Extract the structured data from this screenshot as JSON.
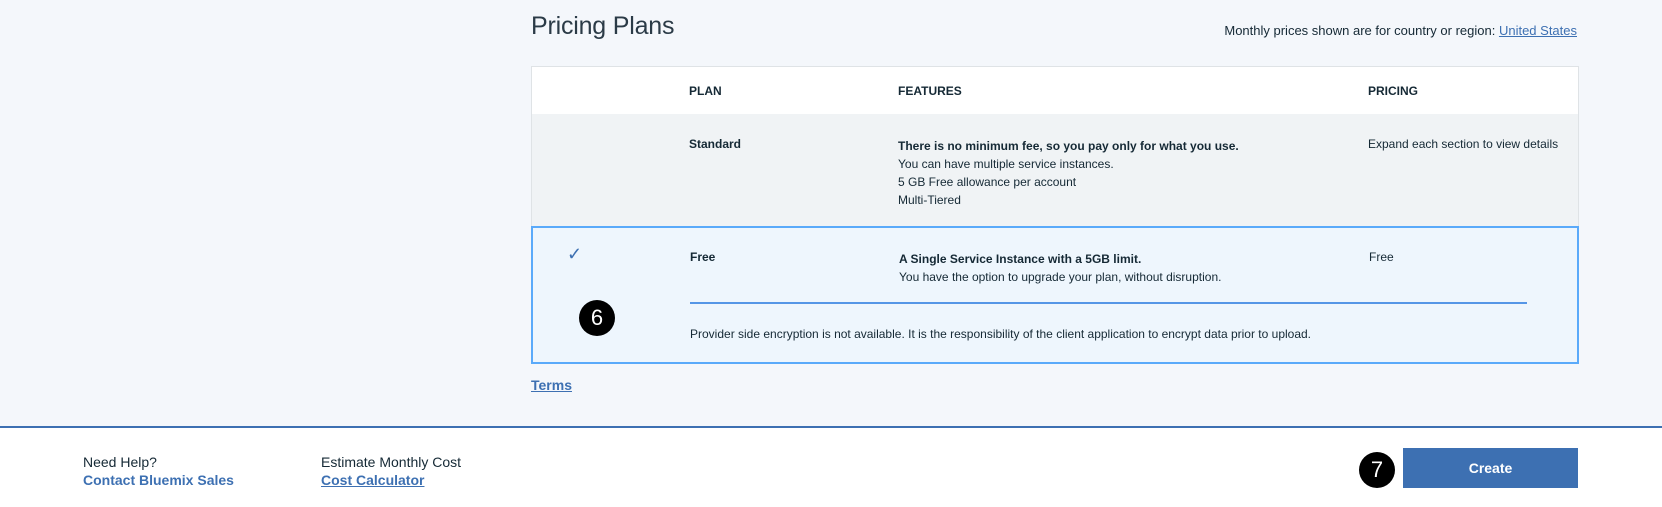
{
  "pricing": {
    "title": "Pricing Plans",
    "region_prefix": "Monthly prices shown are for country or region:",
    "region_link": "United States",
    "headers": {
      "plan": "PLAN",
      "features": "FEATURES",
      "pricing": "PRICING"
    },
    "plans": [
      {
        "name": "Standard",
        "feature_head": "There is no minimum fee, so you pay only for what you use.",
        "features": [
          "You can have multiple service instances.",
          "5 GB Free allowance per account",
          "Multi-Tiered"
        ],
        "pricing": "Expand each section to view details",
        "selected": false
      },
      {
        "name": "Free",
        "feature_head": "A Single Service Instance with a 5GB limit.",
        "features": [
          "You have the option to upgrade your plan, without disruption."
        ],
        "pricing": "Free",
        "note": "Provider side encryption is not available. It is the responsibility of the client application to encrypt data prior to upload.",
        "selected": true,
        "check_icon": "✓"
      }
    ],
    "terms_label": "Terms"
  },
  "markers": {
    "six": "6",
    "seven": "7"
  },
  "footer": {
    "help_label": "Need Help?",
    "help_link": "Contact Bluemix Sales",
    "estimate_label": "Estimate Monthly Cost",
    "estimate_link": "Cost Calculator",
    "create_label": "Create"
  },
  "colors": {
    "accent": "#3d70b2",
    "selected_border": "#5aaafa",
    "selected_bg": "#eef6fd"
  }
}
